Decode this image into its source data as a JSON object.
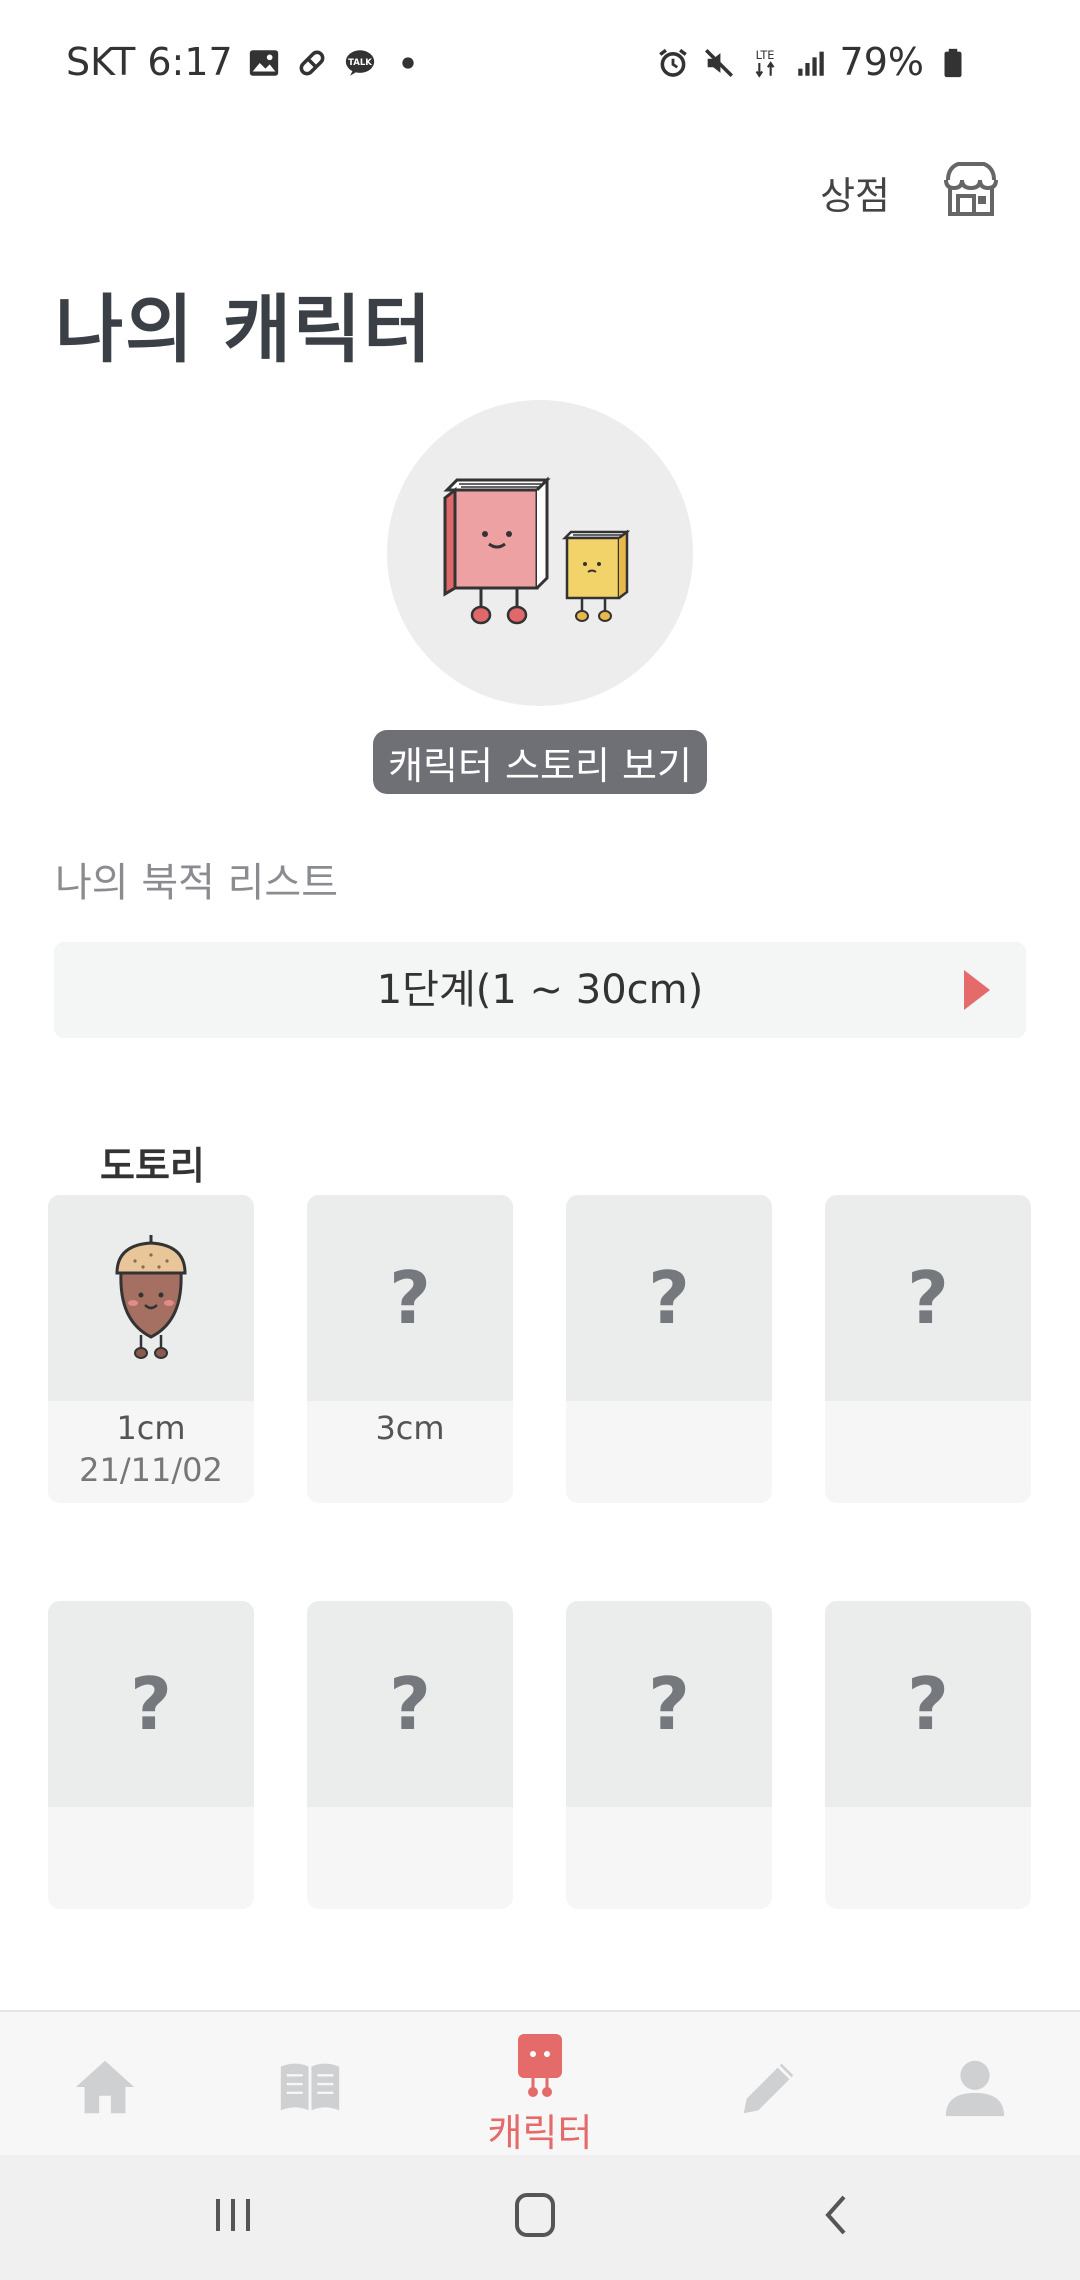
{
  "status_bar": {
    "carrier_time": "SKT 6:17",
    "network": "LTE",
    "battery": "79%",
    "left_icons": [
      "image-icon",
      "pill-icon",
      "talk-icon",
      "dot-icon"
    ],
    "right_icons": [
      "alarm-icon",
      "mute-icon",
      "lte-icon",
      "signal-icon",
      "battery-icon"
    ]
  },
  "header": {
    "shop_label": "상점",
    "shop_icon": "store-icon"
  },
  "title": "나의 캐릭터",
  "character": {
    "icon": "book-characters-icon",
    "story_button": "캐릭터 스토리 보기"
  },
  "bookmark_list": {
    "label": "나의 북적 리스트",
    "level": "1단계(1 ~ 30cm)",
    "group_name": "도토리",
    "cards": [
      {
        "unlocked": true,
        "icon": "acorn-icon",
        "size": "1cm",
        "date": "21/11/02"
      },
      {
        "unlocked": false,
        "q": "?",
        "size": "3cm",
        "date": ""
      },
      {
        "unlocked": false,
        "q": "?",
        "size": "",
        "date": ""
      },
      {
        "unlocked": false,
        "q": "?",
        "size": "",
        "date": ""
      },
      {
        "unlocked": false,
        "q": "?",
        "size": "",
        "date": ""
      },
      {
        "unlocked": false,
        "q": "?",
        "size": "",
        "date": ""
      },
      {
        "unlocked": false,
        "q": "?",
        "size": "",
        "date": ""
      },
      {
        "unlocked": false,
        "q": "?",
        "size": "",
        "date": ""
      }
    ]
  },
  "bottom_nav": {
    "items": [
      {
        "icon": "home-icon"
      },
      {
        "icon": "book-icon"
      },
      {
        "icon": "character-icon",
        "label": "캐릭터",
        "active": true
      },
      {
        "icon": "pencil-icon"
      },
      {
        "icon": "profile-icon"
      }
    ]
  },
  "colors": {
    "accent": "#e56a6a",
    "title": "#3b3f46",
    "card_top": "#ebecec",
    "card_bottom": "#f6f6f6"
  }
}
